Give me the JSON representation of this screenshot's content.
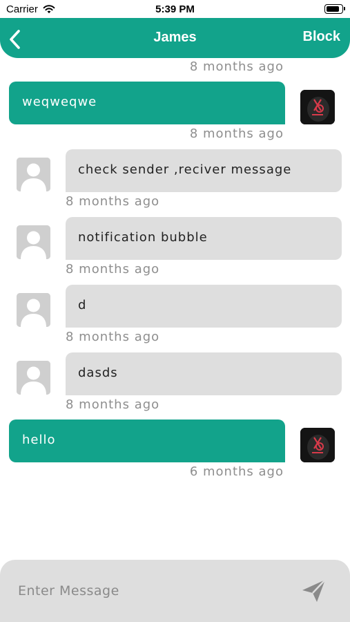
{
  "status_bar": {
    "carrier": "Carrier",
    "time": "5:39 PM",
    "battery_level": 0.9
  },
  "header": {
    "title": "James",
    "block_label": "Block",
    "back_icon": "chevron-left-icon",
    "background_color": "#12a38b"
  },
  "messages": {
    "top_timestamp": "8 months ago",
    "items": [
      {
        "direction": "sent",
        "text": "weqweqwe",
        "time": "8 months ago"
      },
      {
        "direction": "received",
        "text": "check sender ,reciver message",
        "time": "8 months ago"
      },
      {
        "direction": "received",
        "text": "notification bubble",
        "time": "8 months ago"
      },
      {
        "direction": "received",
        "text": "d",
        "time": "8 months ago"
      },
      {
        "direction": "received",
        "text": "dasds",
        "time": "8 months ago"
      },
      {
        "direction": "sent",
        "text": "hello",
        "time": "6 months ago"
      }
    ]
  },
  "composer": {
    "placeholder": "Enter Message",
    "value": "",
    "send_icon": "send-icon"
  },
  "colors": {
    "sent_bubble": "#12a38b",
    "received_bubble": "#dedede",
    "timestamp": "#8e8e8e"
  }
}
